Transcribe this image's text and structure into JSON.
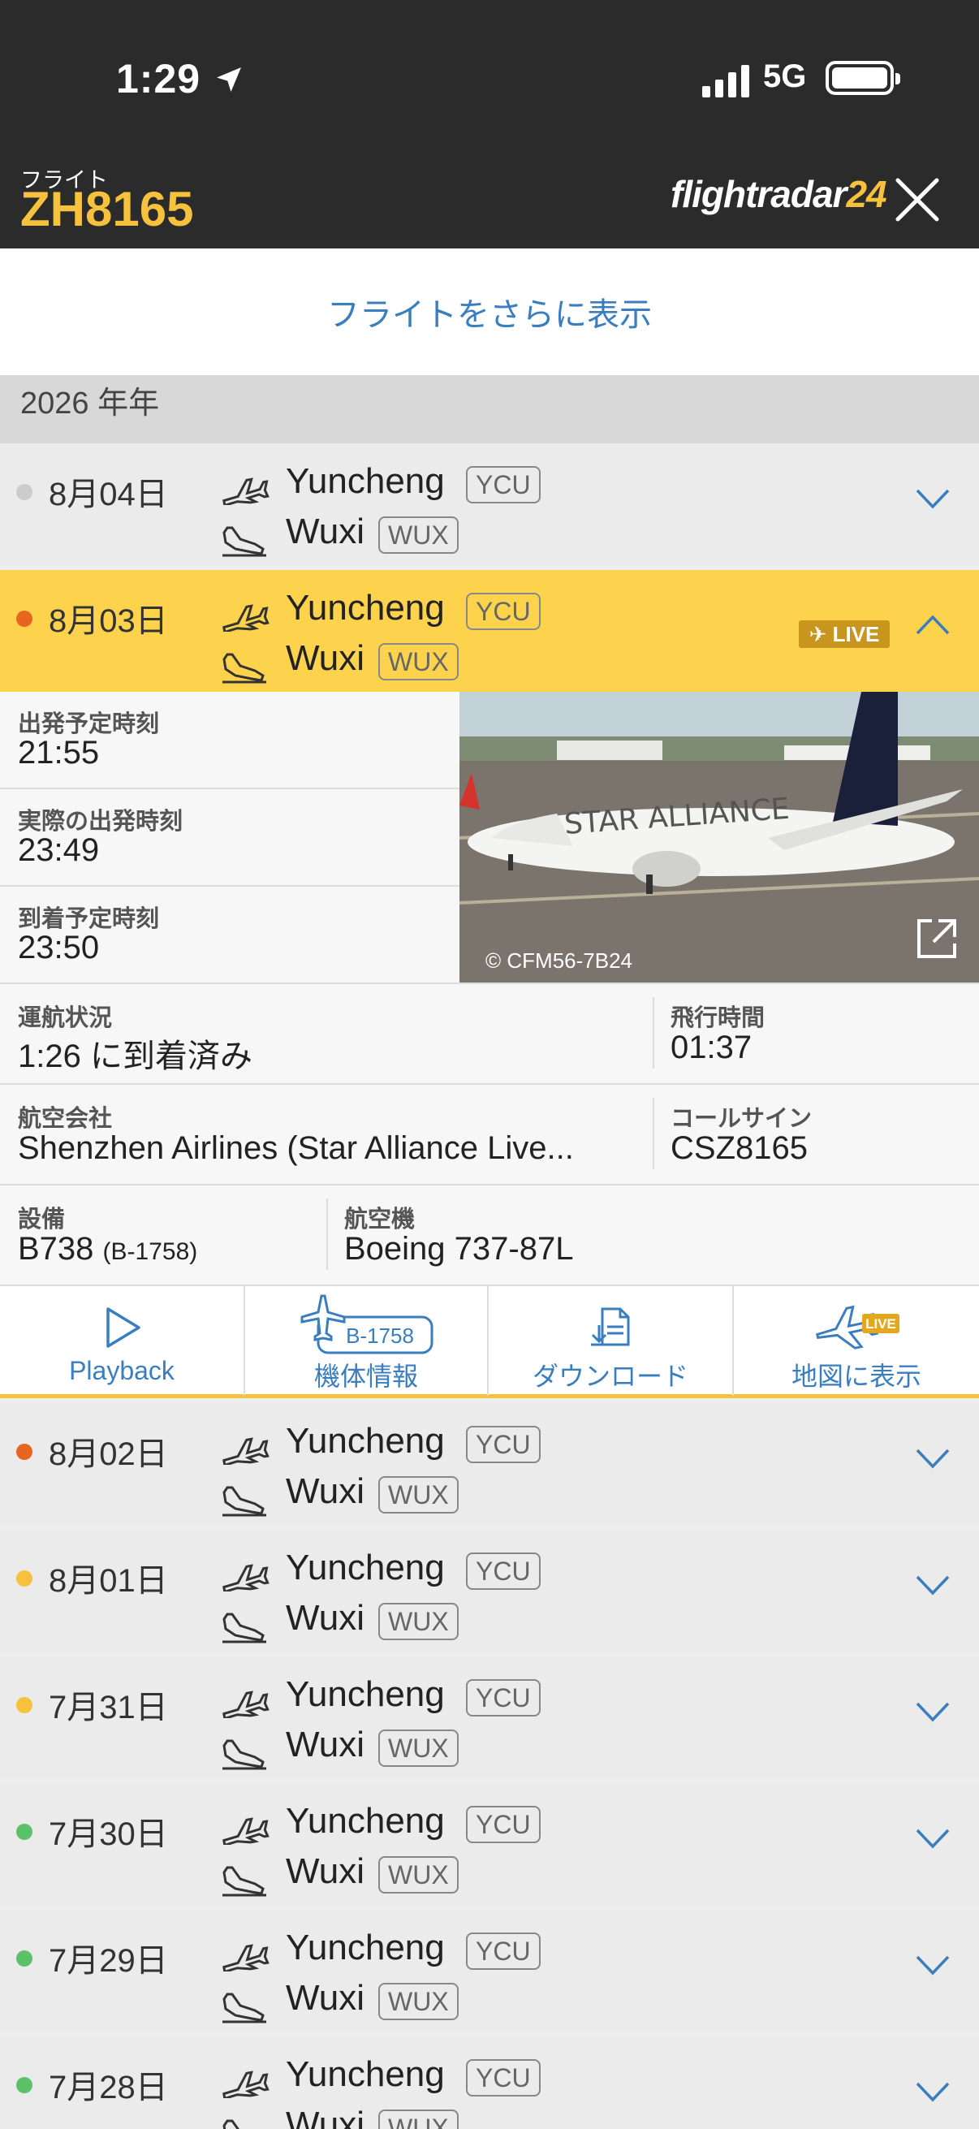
{
  "status_bar": {
    "time": "1:29",
    "network": "5G"
  },
  "header": {
    "label": "フライト",
    "flight": "ZH8165",
    "logo_main": "flightradar",
    "logo_num": "24"
  },
  "more_flights": "フライトをさらに表示",
  "year": "2026 年年",
  "colors": {
    "accent": "#f6c23e",
    "link": "#3a7ebf",
    "dot_grey": "#cccccc",
    "dot_orange": "#e8651f",
    "dot_yellow": "#f6c23e",
    "dot_green": "#5cc26a"
  },
  "flights": [
    {
      "date": "8月04日",
      "from": "Yuncheng",
      "from_code": "YCU",
      "to": "Wuxi",
      "to_code": "WUX",
      "dot": "#cccccc"
    },
    {
      "date": "8月03日",
      "from": "Yuncheng",
      "from_code": "YCU",
      "to": "Wuxi",
      "to_code": "WUX",
      "dot": "#e8651f",
      "live": "LIVE"
    },
    {
      "date": "8月02日",
      "from": "Yuncheng",
      "from_code": "YCU",
      "to": "Wuxi",
      "to_code": "WUX",
      "dot": "#e8651f"
    },
    {
      "date": "8月01日",
      "from": "Yuncheng",
      "from_code": "YCU",
      "to": "Wuxi",
      "to_code": "WUX",
      "dot": "#f6c23e"
    },
    {
      "date": "7月31日",
      "from": "Yuncheng",
      "from_code": "YCU",
      "to": "Wuxi",
      "to_code": "WUX",
      "dot": "#f6c23e"
    },
    {
      "date": "7月30日",
      "from": "Yuncheng",
      "from_code": "YCU",
      "to": "Wuxi",
      "to_code": "WUX",
      "dot": "#5cc26a"
    },
    {
      "date": "7月29日",
      "from": "Yuncheng",
      "from_code": "YCU",
      "to": "Wuxi",
      "to_code": "WUX",
      "dot": "#5cc26a"
    },
    {
      "date": "7月28日",
      "from": "Yuncheng",
      "from_code": "YCU",
      "to": "Wuxi",
      "to_code": "WUX",
      "dot": "#5cc26a"
    }
  ],
  "details": {
    "sched_dep_label": "出発予定時刻",
    "sched_dep": "21:55",
    "actual_dep_label": "実際の出発時刻",
    "actual_dep": "23:49",
    "sched_arr_label": "到着予定時刻",
    "sched_arr": "23:50",
    "status_label": "運航状況",
    "status": "1:26 に到着済み",
    "duration_label": "飛行時間",
    "duration": "01:37",
    "airline_label": "航空会社",
    "airline": "Shenzhen Airlines (Star Alliance Live...",
    "callsign_label": "コールサイン",
    "callsign": "CSZ8165",
    "equip_label": "設備",
    "equip": "B738",
    "equip_reg": "(B-1758)",
    "aircraft_label": "航空機",
    "aircraft": "Boeing 737-87L",
    "photo_caption": "© CFM56-7B24",
    "livery_text": "STAR ALLIANCE"
  },
  "actions": {
    "playback": "Playback",
    "aircraft_info": "機体情報",
    "aircraft_reg": "B-1758",
    "download": "ダウンロード",
    "map": "地図に表示",
    "map_badge": "LIVE"
  }
}
